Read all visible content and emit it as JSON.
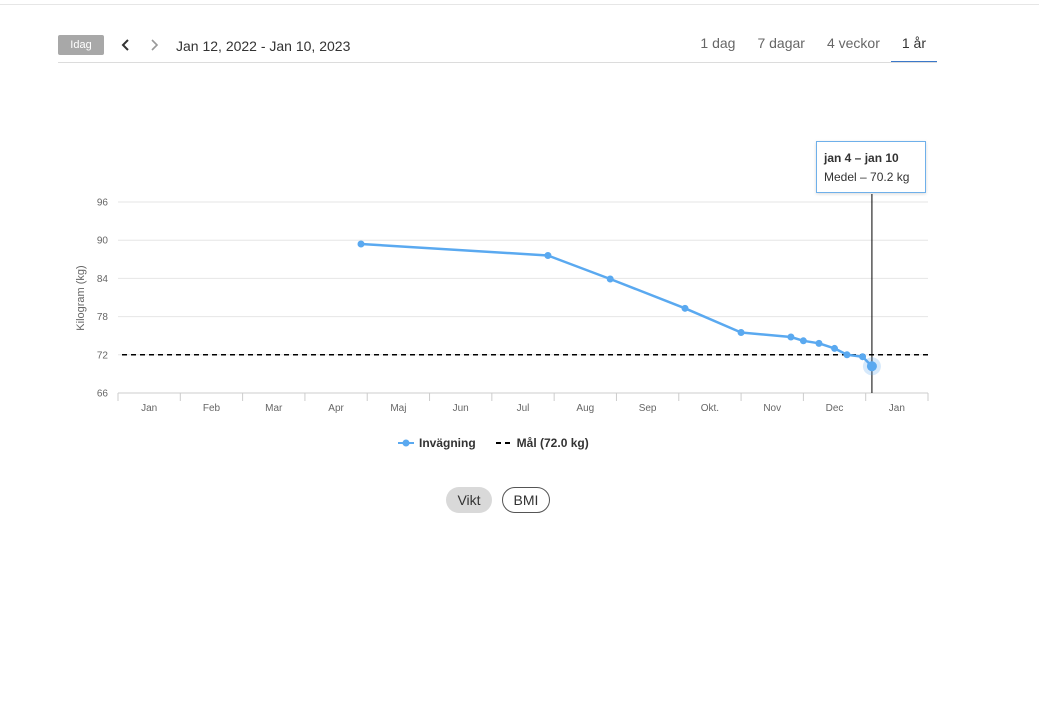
{
  "toolbar": {
    "today_label": "Idag",
    "date_range": "Jan 12, 2022 - Jan 10, 2023",
    "tabs": [
      "1 dag",
      "7 dagar",
      "4 veckor",
      "1 år"
    ],
    "active_tab": "1 år",
    "prev_icon": "chevron-left-icon",
    "next_icon": "chevron-right-icon"
  },
  "tooltip": {
    "title": "jan 4 – jan 10",
    "value": "Medel – 70.2 kg"
  },
  "toggles": {
    "weight_label": "Vikt",
    "bmi_label": "BMI",
    "active": "Vikt"
  },
  "colors": {
    "series": "#5aa9f0",
    "goal_line": "#000000",
    "accent": "#3b78c9"
  },
  "chart_data": {
    "type": "line",
    "ylabel": "Kilogram (kg)",
    "ylim": [
      66,
      96
    ],
    "yticks": [
      66,
      72,
      78,
      84,
      90,
      96
    ],
    "xlim": [
      0,
      13
    ],
    "xtick_labels": [
      "Jan",
      "Feb",
      "Mar",
      "Apr",
      "Maj",
      "Jun",
      "Jul",
      "Aug",
      "Sep",
      "Okt.",
      "Nov",
      "Dec",
      "Jan"
    ],
    "grid": true,
    "legend_position": "bottom-center",
    "series": [
      {
        "name": "Invägning",
        "points": [
          {
            "x": 3.9,
            "y": 89.4
          },
          {
            "x": 6.9,
            "y": 87.6
          },
          {
            "x": 7.9,
            "y": 83.9
          },
          {
            "x": 9.1,
            "y": 79.3
          },
          {
            "x": 10.0,
            "y": 75.5
          },
          {
            "x": 10.8,
            "y": 74.8
          },
          {
            "x": 11.0,
            "y": 74.2
          },
          {
            "x": 11.25,
            "y": 73.8
          },
          {
            "x": 11.5,
            "y": 73.0
          },
          {
            "x": 11.7,
            "y": 72.0
          },
          {
            "x": 11.95,
            "y": 71.7
          },
          {
            "x": 12.1,
            "y": 70.2
          }
        ]
      }
    ],
    "goal": {
      "name": "Mål (72.0 kg)",
      "value": 72.0
    },
    "highlight_index": 11
  }
}
